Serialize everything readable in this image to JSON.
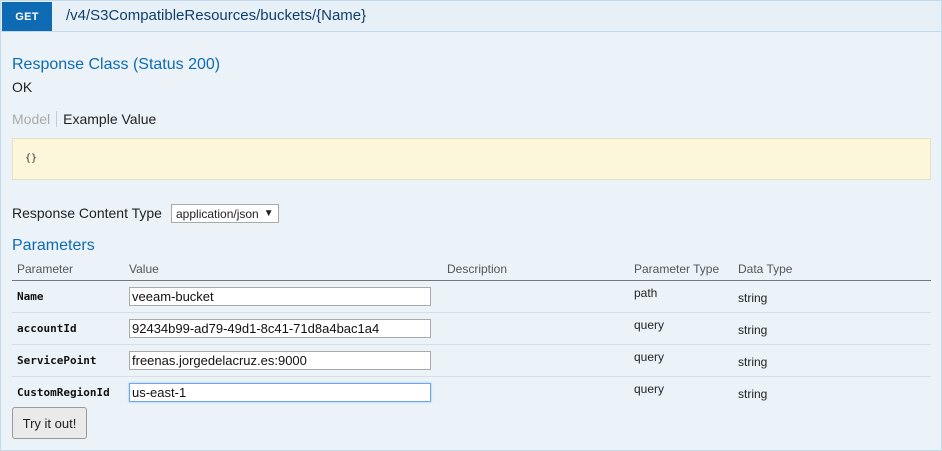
{
  "operation": {
    "method": "GET",
    "path": "/v4/S3CompatibleResources/buckets/{Name}"
  },
  "response_class": {
    "heading": "Response Class (Status 200)",
    "status_text": "OK",
    "tabs": {
      "model": "Model",
      "example": "Example Value"
    },
    "example_value": "{}"
  },
  "response_content_type": {
    "label": "Response Content Type",
    "selected": "application/json"
  },
  "parameters": {
    "heading": "Parameters",
    "columns": {
      "parameter": "Parameter",
      "value": "Value",
      "description": "Description",
      "parameter_type": "Parameter Type",
      "data_type": "Data Type"
    },
    "rows": [
      {
        "name": "Name",
        "value": "veeam-bucket",
        "description": "",
        "param_type": "path",
        "data_type": "string"
      },
      {
        "name": "accountId",
        "value": "92434b99-ad79-49d1-8c41-71d8a4bac1a4",
        "description": "",
        "param_type": "query",
        "data_type": "string"
      },
      {
        "name": "ServicePoint",
        "value": "freenas.jorgedelacruz.es:9000",
        "description": "",
        "param_type": "query",
        "data_type": "string"
      },
      {
        "name": "CustomRegionId",
        "value": "us-east-1",
        "description": "",
        "param_type": "query",
        "data_type": "string"
      }
    ]
  },
  "try_button": {
    "label": "Try it out!"
  },
  "colors": {
    "get_badge": "#0f6ab4",
    "heading_blue": "#0f6ab4",
    "panel_bg": "#ebf3f9",
    "example_bg": "#fcf6db"
  }
}
